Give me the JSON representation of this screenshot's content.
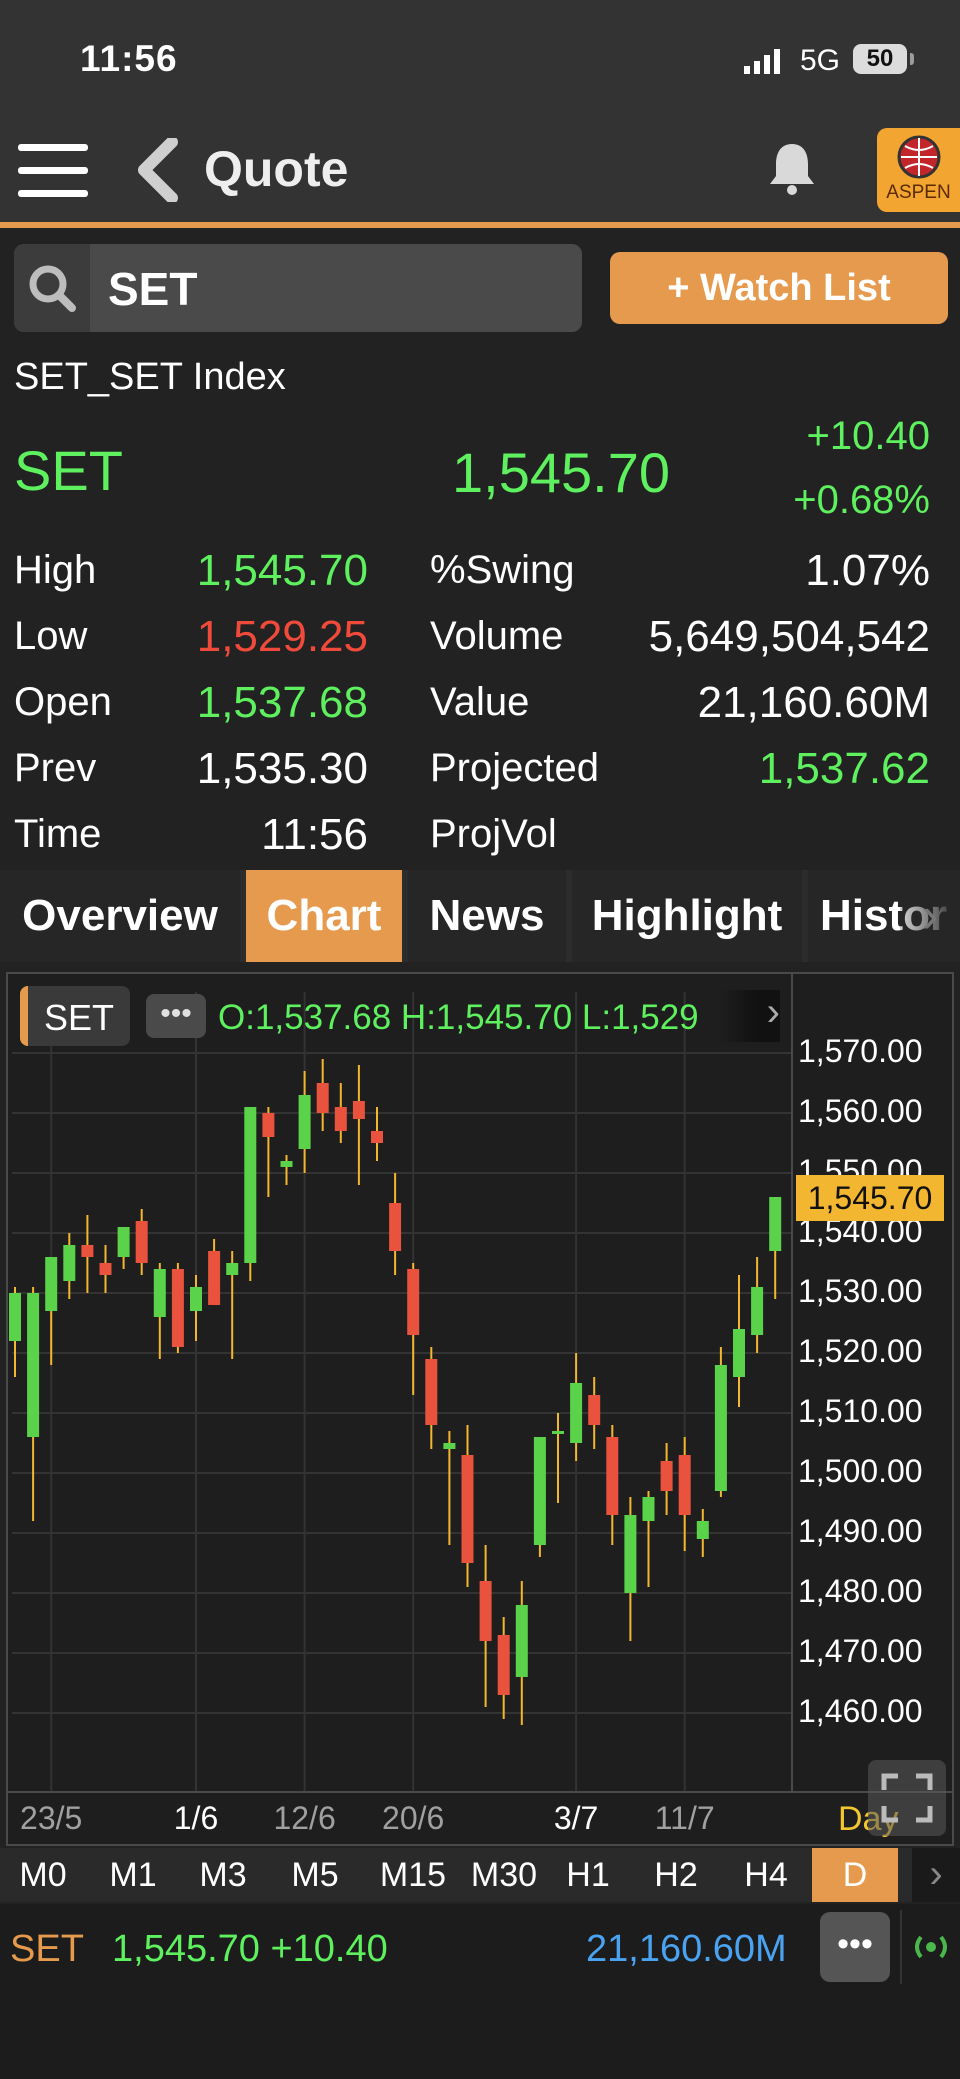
{
  "status_bar": {
    "time": "11:56",
    "network": "5G",
    "battery": "50"
  },
  "header": {
    "title": "Quote",
    "logo_text": "ASPEN"
  },
  "search": {
    "value": "SET",
    "watch_button": "+ Watch List"
  },
  "quote": {
    "index_name": "SET_SET Index",
    "symbol": "SET",
    "last": "1,545.70",
    "change": "+10.40",
    "change_pct": "+0.68%",
    "left_stats": [
      {
        "label": "High",
        "value": "1,545.70",
        "color": "green"
      },
      {
        "label": "Low",
        "value": "1,529.25",
        "color": "red"
      },
      {
        "label": "Open",
        "value": "1,537.68",
        "color": "green"
      },
      {
        "label": "Prev",
        "value": "1,535.30",
        "color": "white"
      },
      {
        "label": "Time",
        "value": "11:56",
        "color": "white"
      }
    ],
    "right_stats": [
      {
        "label": "%Swing",
        "value": "1.07%",
        "color": "white"
      },
      {
        "label": "Volume",
        "value": "5,649,504,542",
        "color": "white"
      },
      {
        "label": "Value",
        "value": "21,160.60M",
        "color": "white"
      },
      {
        "label": "Projected",
        "value": "1,537.62",
        "color": "green"
      },
      {
        "label": "ProjVol",
        "value": "",
        "color": "white"
      }
    ]
  },
  "tabs": [
    "Overview",
    "Chart",
    "News",
    "Highlight",
    "Histor"
  ],
  "active_tab": "Chart",
  "chart_overlay": {
    "symbol_badge": "SET",
    "ohlc_text": "O:1,537.68  H:1,545.70  L:1,529",
    "last_price_tag": "1,545.70",
    "period_label": "Day"
  },
  "chart_data": {
    "type": "candlestick",
    "period": "Day",
    "y_ticks": [
      "1,570.00",
      "1,560.00",
      "1,550.00",
      "1,540.00",
      "1,530.00",
      "1,520.00",
      "1,510.00",
      "1,500.00",
      "1,490.00",
      "1,480.00",
      "1,470.00",
      "1,460.00"
    ],
    "ylim": [
      1454,
      1571
    ],
    "x_labels": [
      {
        "label": "23/5",
        "index": 2,
        "highlight": false
      },
      {
        "label": "1/6",
        "index": 10,
        "highlight": true
      },
      {
        "label": "12/6",
        "index": 16,
        "highlight": false
      },
      {
        "label": "20/6",
        "index": 22,
        "highlight": false
      },
      {
        "label": "3/7",
        "index": 31,
        "highlight": true
      },
      {
        "label": "11/7",
        "index": 37,
        "highlight": false
      }
    ],
    "candles": [
      {
        "o": 1522,
        "h": 1531,
        "l": 1516,
        "c": 1530
      },
      {
        "o": 1506,
        "h": 1531,
        "l": 1492,
        "c": 1530
      },
      {
        "o": 1527,
        "h": 1535,
        "l": 1518,
        "c": 1536
      },
      {
        "o": 1532,
        "h": 1540,
        "l": 1529,
        "c": 1538
      },
      {
        "o": 1538,
        "h": 1543,
        "l": 1530,
        "c": 1536
      },
      {
        "o": 1535,
        "h": 1538,
        "l": 1530,
        "c": 1533
      },
      {
        "o": 1536,
        "h": 1540,
        "l": 1534,
        "c": 1541
      },
      {
        "o": 1542,
        "h": 1544,
        "l": 1533,
        "c": 1535
      },
      {
        "o": 1526,
        "h": 1535,
        "l": 1519,
        "c": 1534
      },
      {
        "o": 1534,
        "h": 1535,
        "l": 1520,
        "c": 1521
      },
      {
        "o": 1527,
        "h": 1533,
        "l": 1522,
        "c": 1531
      },
      {
        "o": 1537,
        "h": 1539,
        "l": 1528,
        "c": 1528
      },
      {
        "o": 1533,
        "h": 1537,
        "l": 1519,
        "c": 1535
      },
      {
        "o": 1535,
        "h": 1561,
        "l": 1532,
        "c": 1561
      },
      {
        "o": 1560,
        "h": 1561,
        "l": 1546,
        "c": 1556
      },
      {
        "o": 1551,
        "h": 1553,
        "l": 1548,
        "c": 1552
      },
      {
        "o": 1554,
        "h": 1567,
        "l": 1550,
        "c": 1563
      },
      {
        "o": 1565,
        "h": 1569,
        "l": 1557,
        "c": 1560
      },
      {
        "o": 1561,
        "h": 1565,
        "l": 1555,
        "c": 1557
      },
      {
        "o": 1562,
        "h": 1568,
        "l": 1548,
        "c": 1559
      },
      {
        "o": 1557,
        "h": 1561,
        "l": 1552,
        "c": 1555
      },
      {
        "o": 1545,
        "h": 1550,
        "l": 1533,
        "c": 1537
      },
      {
        "o": 1534,
        "h": 1535,
        "l": 1513,
        "c": 1523
      },
      {
        "o": 1519,
        "h": 1521,
        "l": 1504,
        "c": 1508
      },
      {
        "o": 1504,
        "h": 1507,
        "l": 1488,
        "c": 1505
      },
      {
        "o": 1503,
        "h": 1508,
        "l": 1481,
        "c": 1485
      },
      {
        "o": 1482,
        "h": 1488,
        "l": 1461,
        "c": 1472
      },
      {
        "o": 1473,
        "h": 1476,
        "l": 1459,
        "c": 1463
      },
      {
        "o": 1466,
        "h": 1482,
        "l": 1458,
        "c": 1478
      },
      {
        "o": 1488,
        "h": 1505,
        "l": 1486,
        "c": 1506
      },
      {
        "o": 1507,
        "h": 1510,
        "l": 1495,
        "c": 1507
      },
      {
        "o": 1505,
        "h": 1520,
        "l": 1502,
        "c": 1515
      },
      {
        "o": 1513,
        "h": 1516,
        "l": 1504,
        "c": 1508
      },
      {
        "o": 1506,
        "h": 1508,
        "l": 1488,
        "c": 1493
      },
      {
        "o": 1480,
        "h": 1496,
        "l": 1472,
        "c": 1493
      },
      {
        "o": 1492,
        "h": 1497,
        "l": 1481,
        "c": 1496
      },
      {
        "o": 1502,
        "h": 1505,
        "l": 1493,
        "c": 1497
      },
      {
        "o": 1503,
        "h": 1506,
        "l": 1487,
        "c": 1493
      },
      {
        "o": 1489,
        "h": 1494,
        "l": 1486,
        "c": 1492
      },
      {
        "o": 1497,
        "h": 1521,
        "l": 1496,
        "c": 1518
      },
      {
        "o": 1516,
        "h": 1533,
        "l": 1511,
        "c": 1524
      },
      {
        "o": 1523,
        "h": 1536,
        "l": 1520,
        "c": 1531
      },
      {
        "o": 1537,
        "h": 1546,
        "l": 1529,
        "c": 1546
      }
    ],
    "up_color": "#5ad24a",
    "down_color": "#e9523c",
    "wick_color": "#f2b630",
    "grid": true
  },
  "timeframes": [
    "M0",
    "M1",
    "M3",
    "M5",
    "M15",
    "M30",
    "H1",
    "H2",
    "H4",
    "D"
  ],
  "active_timeframe": "D",
  "bottom_bar": {
    "symbol": "SET",
    "last_change": "1,545.70 +10.40",
    "value": "21,160.60M"
  },
  "colors": {
    "accent": "#e59a4d",
    "up": "#5ef05e",
    "down": "#f04a3a",
    "value_blue": "#4aa3f0"
  }
}
